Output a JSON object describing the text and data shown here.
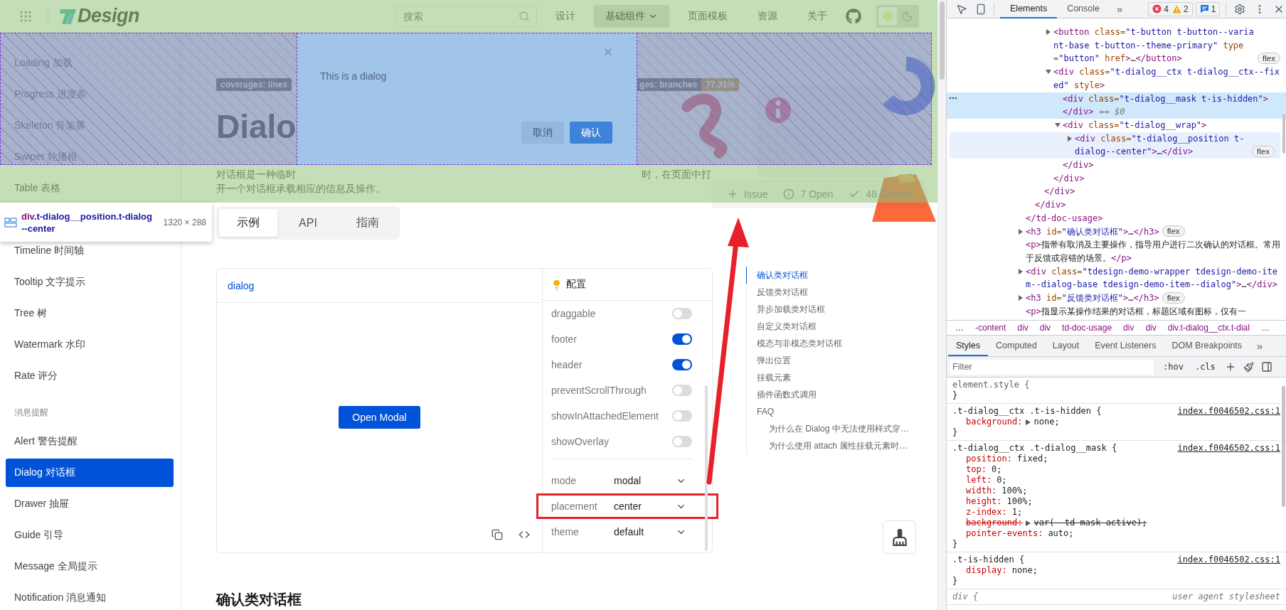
{
  "header": {
    "logo": "Design",
    "search": {
      "placeholder": "搜索"
    },
    "nav": [
      {
        "label": "设计",
        "selected": false,
        "dropdown": false
      },
      {
        "label": "基础组件",
        "selected": true,
        "dropdown": true
      },
      {
        "label": "页面模板",
        "selected": false,
        "dropdown": false
      },
      {
        "label": "资源",
        "selected": false,
        "dropdown": false
      },
      {
        "label": "关于",
        "selected": false,
        "dropdown": false
      }
    ],
    "theme": [
      {
        "kind": "light",
        "selected": true
      },
      {
        "kind": "dark",
        "selected": false
      }
    ]
  },
  "sidebar": {
    "sections": [
      {
        "items": [
          {
            "label": "Loading 加载",
            "selected": false
          },
          {
            "label": "Progress 进度条",
            "selected": false
          },
          {
            "label": "Skeleton 骨架屏",
            "selected": false
          },
          {
            "label": "Swiper 轮播框",
            "selected": false
          },
          {
            "label": "Table 表格",
            "selected": false
          }
        ]
      },
      {
        "items": [
          {
            "label": "Timeline 时间轴",
            "selected": false
          },
          {
            "label": "Tooltip 文字提示",
            "selected": false
          },
          {
            "label": "Tree 树",
            "selected": false
          },
          {
            "label": "Watermark 水印",
            "selected": false
          },
          {
            "label": "Rate 评分",
            "selected": false
          }
        ]
      },
      {
        "title": "消息提醒",
        "items": [
          {
            "label": "Alert 警告提醒",
            "selected": false
          },
          {
            "label": "Dialog 对话框",
            "selected": true
          },
          {
            "label": "Drawer 抽屉",
            "selected": false
          },
          {
            "label": "Guide 引导",
            "selected": false
          },
          {
            "label": "Message 全局提示",
            "selected": false
          },
          {
            "label": "Notification 消息通知",
            "selected": false
          }
        ]
      }
    ]
  },
  "hero": {
    "badges": [
      {
        "label": "coverages: lines"
      },
      {
        "label": "ges: branches",
        "value": "77.31%"
      }
    ],
    "title": "Dialo",
    "description": [
      [
        "对话框是一种临时",
        "时，在页面中打"
      ],
      [
        "开一个对话框承载相应的信息及操作。"
      ]
    ],
    "issues": [
      {
        "kind": "add",
        "label": "Issue"
      },
      {
        "kind": "open",
        "label": "7 Open"
      },
      {
        "kind": "closed",
        "label": "48 Closed"
      }
    ]
  },
  "dialog": {
    "body": "This is a dialog",
    "buttons": [
      {
        "label": "取消",
        "kind": "secondary"
      },
      {
        "label": "确认",
        "kind": "primary"
      }
    ]
  },
  "inspector_tooltip": {
    "tag": "div",
    "selector": ".t-dialog__position.t-dialog--center",
    "size": "1320 × 288"
  },
  "doc_tabs": [
    {
      "label": "示例",
      "selected": true
    },
    {
      "label": "API",
      "selected": false
    },
    {
      "label": "指南",
      "selected": false
    }
  ],
  "demo": {
    "title": "dialog",
    "button": "Open Modal",
    "config": {
      "title": "配置",
      "toggles": [
        {
          "label": "draggable",
          "on": false
        },
        {
          "label": "footer",
          "on": true
        },
        {
          "label": "header",
          "on": true
        },
        {
          "label": "preventScrollThrough",
          "on": false
        },
        {
          "label": "showInAttachedElement",
          "on": false
        },
        {
          "label": "showOverlay",
          "on": false
        }
      ],
      "selects": [
        {
          "label": "mode",
          "value": "modal",
          "highlighted": false
        },
        {
          "label": "placement",
          "value": "center",
          "highlighted": true
        },
        {
          "label": "theme",
          "value": "default",
          "highlighted": false
        }
      ]
    }
  },
  "toc": [
    {
      "label": "确认类对话框",
      "selected": true
    },
    {
      "label": "反馈类对话框",
      "selected": false
    },
    {
      "label": "异步加载类对话框",
      "selected": false
    },
    {
      "label": "自定义类对话框",
      "selected": false
    },
    {
      "label": "模态与非模态类对话框",
      "selected": false
    },
    {
      "label": "弹出位置",
      "selected": false
    },
    {
      "label": "挂载元素",
      "selected": false
    },
    {
      "label": "插件函数式调用",
      "selected": false
    },
    {
      "label": "FAQ",
      "selected": false,
      "children": [
        {
          "label": "为什么在 Dialog 中无法使用样式穿…",
          "selected": false
        },
        {
          "label": "为什么使用 attach 属性挂载元素时…",
          "selected": false
        }
      ]
    }
  ],
  "section_heading": "确认类对话框",
  "devtools": {
    "tabs": [
      {
        "label": "Elements",
        "selected": true
      },
      {
        "label": "Console",
        "selected": false
      }
    ],
    "more": "»",
    "errors": "4",
    "warnings": "2",
    "messages": "1",
    "dom_tree": [
      {
        "close": "</td-doc-usage>",
        "children": [
          {
            "close": "</div>",
            "children": [
              {
                "close": "</div>",
                "children": [
                  {
                    "text": "<button class=\"t-button t-button--variant-base t-button--theme-primary\" type=\"button\" href>…</button>",
                    "expanded": false,
                    "badge": "flex",
                    "selected": false
                  },
                  {
                    "text": "<div class=\"t-dialog__ctx t-dialog__ctx--fixed\" style>",
                    "expanded": true,
                    "close": "</div>",
                    "selected": false,
                    "children": [
                      {
                        "text": "<div class=\"t-dialog__mask t-is-hidden\">",
                        "close": "</div>",
                        "suffix": "== $0",
                        "selected": true
                      },
                      {
                        "text": "<div class=\"t-dialog__wrap\">",
                        "expanded": true,
                        "close": "</div>",
                        "selected": false,
                        "children": [
                          {
                            "text": "<div class=\"t-dialog__position t-dialog--center\">…</div>",
                            "expanded": false,
                            "badge": "flex",
                            "selected": false,
                            "hovered": true
                          }
                        ]
                      }
                    ]
                  }
                ]
              }
            ]
          }
        ]
      },
      {
        "text": "<h3 id=\"确认类对话框\">…</h3>",
        "expanded": false,
        "badge": "flex",
        "selected": false
      },
      {
        "text": "<p>指带有取消及主要操作，指导用户进行二次确认的对话框。常用于反馈或容错的场景。</p>",
        "selected": false
      },
      {
        "text": "<div class=\"tdesign-demo-wrapper tdesign-demo-item--dialog-base tdesign-demo-item--dialog\">…</div>",
        "expanded": false,
        "selected": false
      },
      {
        "text": "<h3 id=\"反馈类对话框\">…</h3>",
        "expanded": false,
        "badge": "flex",
        "selected": false
      },
      {
        "text": "<p>指显示某操作结果的对话框，标题区域有图标，仅有一",
        "selected": false
      }
    ],
    "breadcrumbs": [
      {
        "label": "…",
        "kind": "more"
      },
      {
        "label": "-content",
        "kind": "node"
      },
      {
        "label": "div",
        "kind": "node"
      },
      {
        "label": "div",
        "kind": "node"
      },
      {
        "label": "td-doc-usage",
        "kind": "node"
      },
      {
        "label": "div",
        "kind": "node"
      },
      {
        "label": "div",
        "kind": "node"
      },
      {
        "label": "div.t-dialog__ctx.t-dial",
        "kind": "node"
      },
      {
        "label": "…",
        "kind": "more"
      }
    ],
    "style_tabs": [
      {
        "label": "Styles",
        "selected": true
      },
      {
        "label": "Computed",
        "selected": false
      },
      {
        "label": "Layout",
        "selected": false
      },
      {
        "label": "Event Listeners",
        "selected": false
      },
      {
        "label": "DOM Breakpoints",
        "selected": false
      }
    ],
    "style_tabs_more": "»",
    "filter": {
      "placeholder": "Filter"
    },
    "filter_buttons": [
      ":hov",
      ".cls"
    ],
    "rules": [
      {
        "kind": "inline",
        "selector": "element.style {",
        "close": "}"
      },
      {
        "kind": "author",
        "selector": ".t-dialog__ctx .t-is-hidden {",
        "source": "index.f0046502.css:1",
        "close": "}",
        "declarations": [
          {
            "property": "background:",
            "value": "none;",
            "expandable": true,
            "overridden": false
          }
        ]
      },
      {
        "kind": "author",
        "selector": ".t-dialog__ctx .t-dialog__mask {",
        "source": "index.f0046502.css:1",
        "close": "}",
        "declarations": [
          {
            "property": "position:",
            "value": "fixed;",
            "expandable": false,
            "overridden": false
          },
          {
            "property": "top:",
            "value": "0;",
            "expandable": false,
            "overridden": false
          },
          {
            "property": "left:",
            "value": "0;",
            "expandable": false,
            "overridden": false
          },
          {
            "property": "width:",
            "value": "100%;",
            "expandable": false,
            "overridden": false
          },
          {
            "property": "height:",
            "value": "100%;",
            "expandable": false,
            "overridden": false
          },
          {
            "property": "z-index:",
            "value": "1;",
            "expandable": false,
            "overridden": false
          },
          {
            "property": "background:",
            "value": "var(--td-mask-active);",
            "expandable": true,
            "overridden": true
          },
          {
            "property": "pointer-events:",
            "value": "auto;",
            "expandable": false,
            "overridden": false
          }
        ]
      },
      {
        "kind": "author",
        "selector": ".t-is-hidden {",
        "source": "index.f0046502.css:1",
        "close": "}",
        "declarations": [
          {
            "property": "display:",
            "value": "none;",
            "expandable": false,
            "overridden": false
          }
        ]
      },
      {
        "kind": "user-agent",
        "selector": "div {",
        "source": "user agent stylesheet"
      }
    ]
  }
}
